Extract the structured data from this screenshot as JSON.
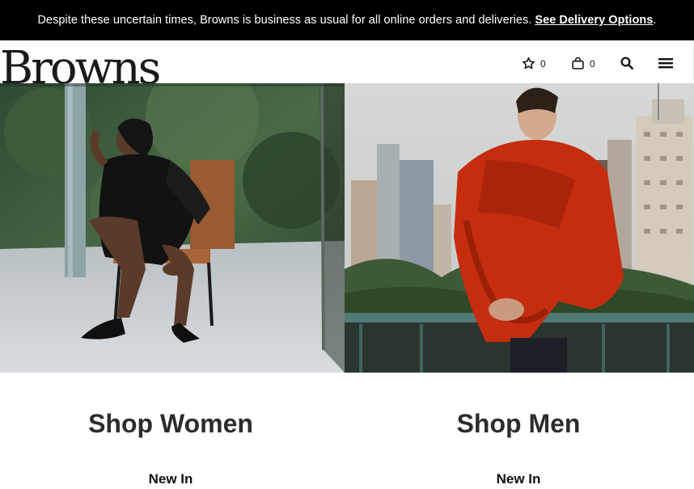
{
  "banner": {
    "message": "Despite these uncertain times, Browns is business as usual for all online orders and deliveries.",
    "link": "See Delivery Options",
    "trailing": "."
  },
  "header": {
    "logo": "Browns",
    "wishlist_count": "0",
    "bag_count": "0",
    "icons": [
      "star-icon",
      "bag-icon",
      "search-icon",
      "menu-icon"
    ]
  },
  "hero": {
    "women_image": "woman-in-black-leather-jacket-photo",
    "men_image": "man-in-red-sweater-photo"
  },
  "columns": [
    {
      "title": "Shop Women",
      "link": "New In"
    },
    {
      "title": "Shop Men",
      "link": "New In"
    }
  ]
}
